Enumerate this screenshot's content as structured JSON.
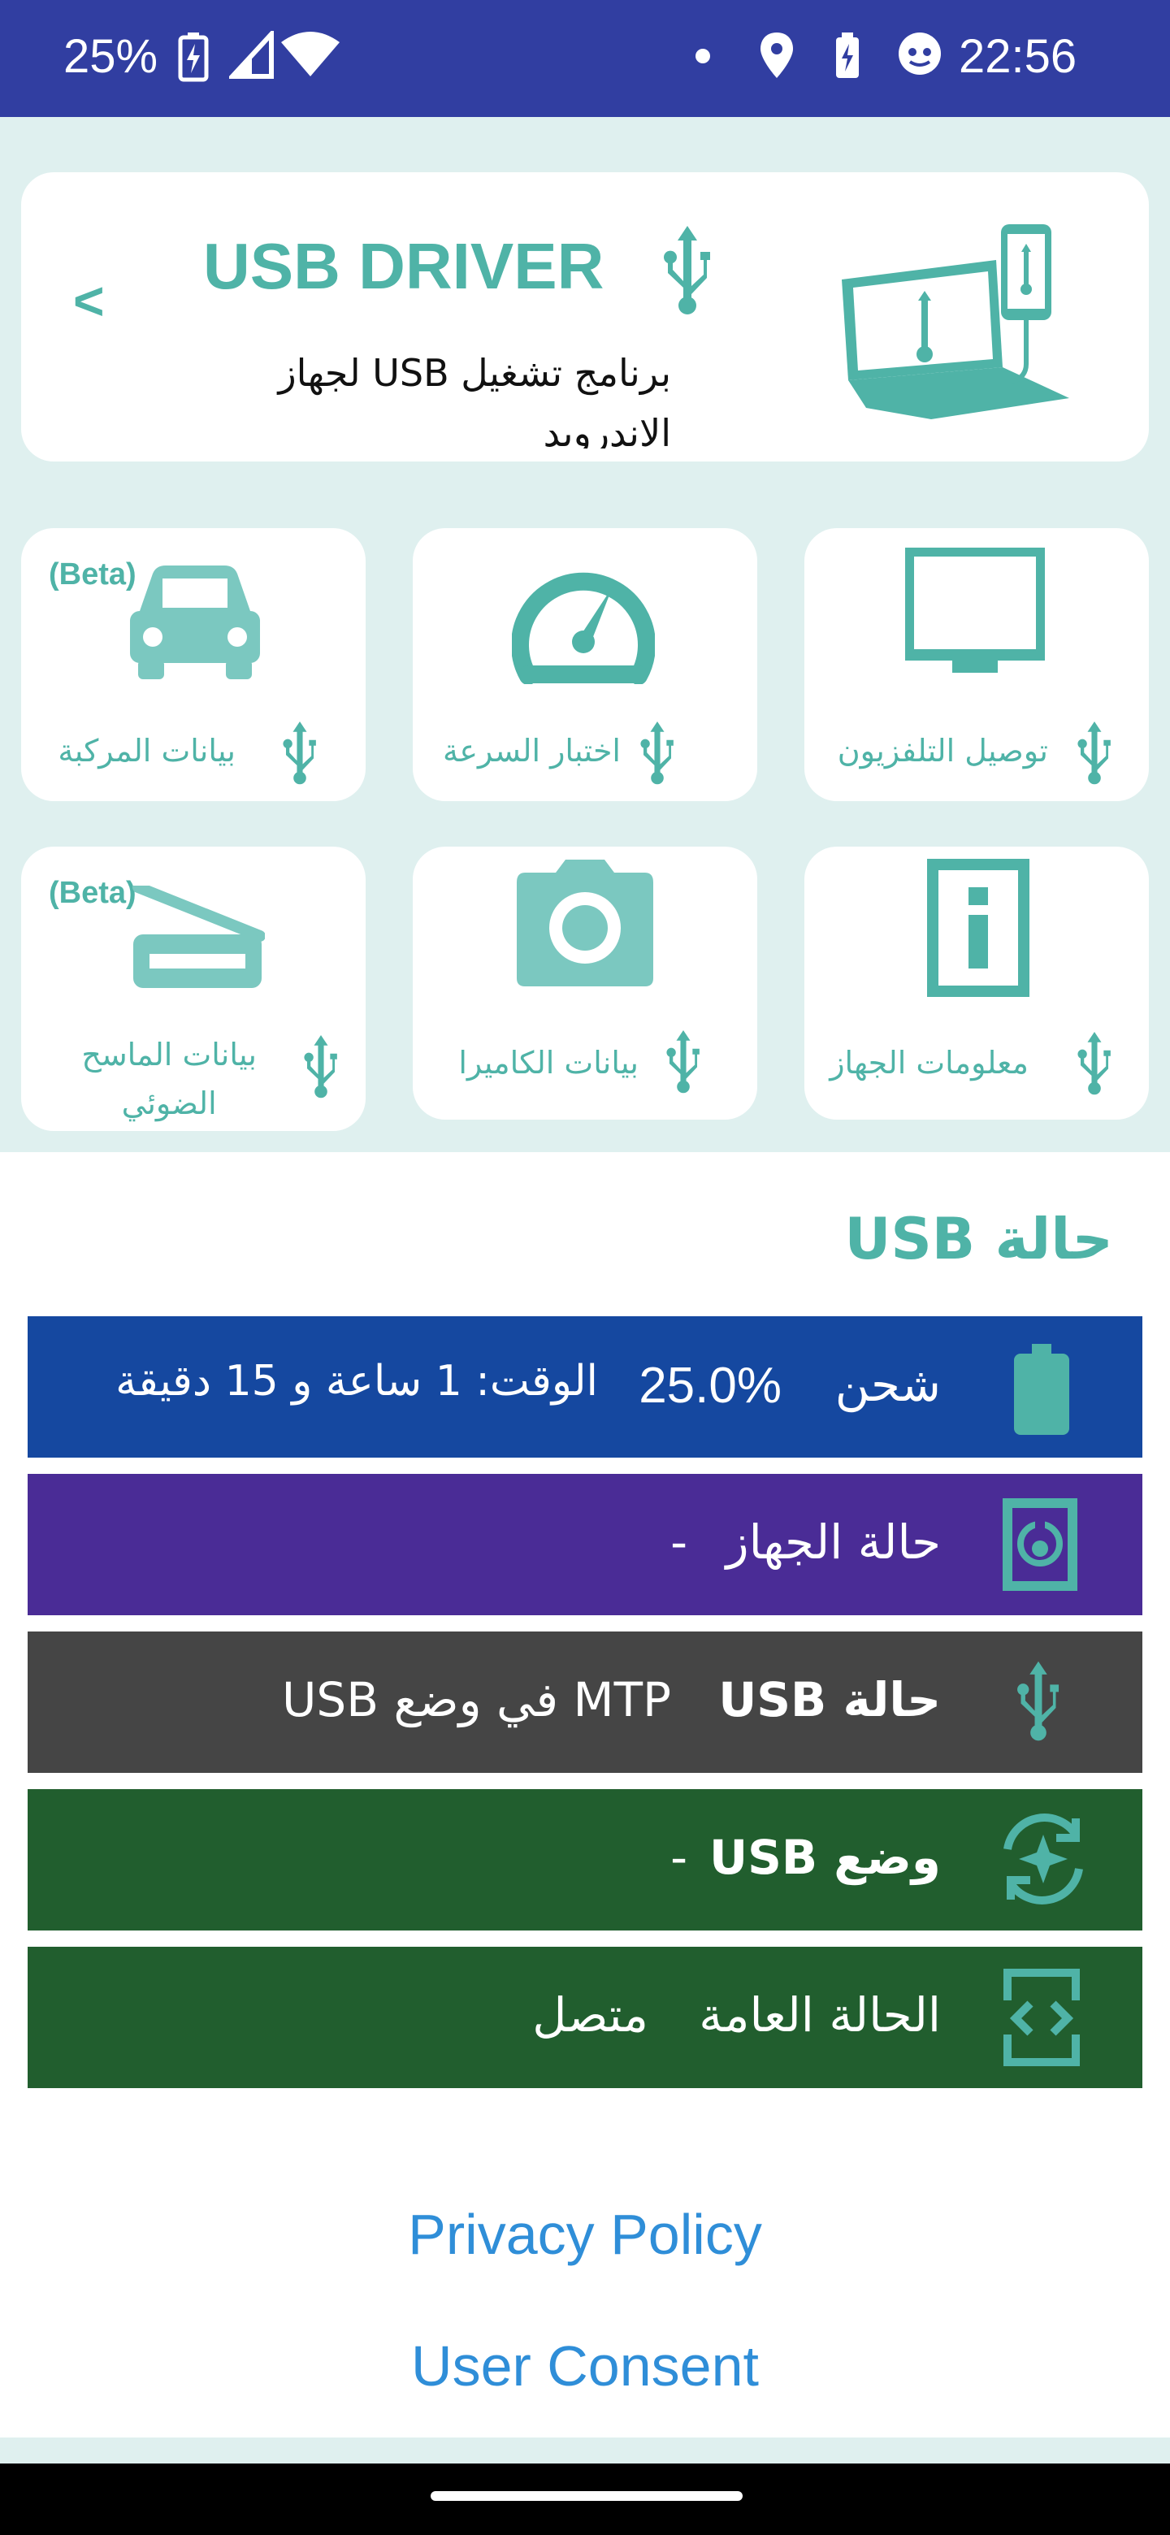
{
  "status_bar": {
    "battery_percent": "25%",
    "time": "22:56"
  },
  "header_card": {
    "title": "USB DRIVER",
    "subtitle": "برنامج تشغيل USB لجهاز",
    "subtitle_cut": "الاندرويد",
    "back_label": "<"
  },
  "tiles": [
    {
      "label": "توصيل التلفزيون",
      "beta": ""
    },
    {
      "label": "اختبار السرعة",
      "beta": ""
    },
    {
      "label": "بيانات المركبة",
      "beta": "(Beta)"
    },
    {
      "label": "معلومات الجهاز",
      "beta": ""
    },
    {
      "label": "بيانات الكاميرا",
      "beta": ""
    },
    {
      "label_line1": "بيانات الماسح",
      "label_line2": "الضوئي",
      "beta": "(Beta)"
    }
  ],
  "section": {
    "title": "حالة USB"
  },
  "status_rows": [
    {
      "label": "شحن",
      "value": "25.0%",
      "extra": "الوقت: 1 ساعة و 15 دقيقة",
      "color": "#1548a0"
    },
    {
      "label": "حالة الجهاز",
      "value": "-",
      "color": "#4a2c96"
    },
    {
      "label": "حالة USB",
      "value": "MTP في وضع USB",
      "color": "#454545"
    },
    {
      "label": "وضع USB",
      "value": "-",
      "color": "#215e2e"
    },
    {
      "label": "الحالة العامة",
      "value": "متصل",
      "color": "#215e2e"
    }
  ],
  "links": {
    "privacy": "Privacy Policy",
    "consent": "User Consent"
  },
  "colors": {
    "accent": "#4fb3a7",
    "status_bar": "#313ea1",
    "link": "#2f8ed8"
  }
}
